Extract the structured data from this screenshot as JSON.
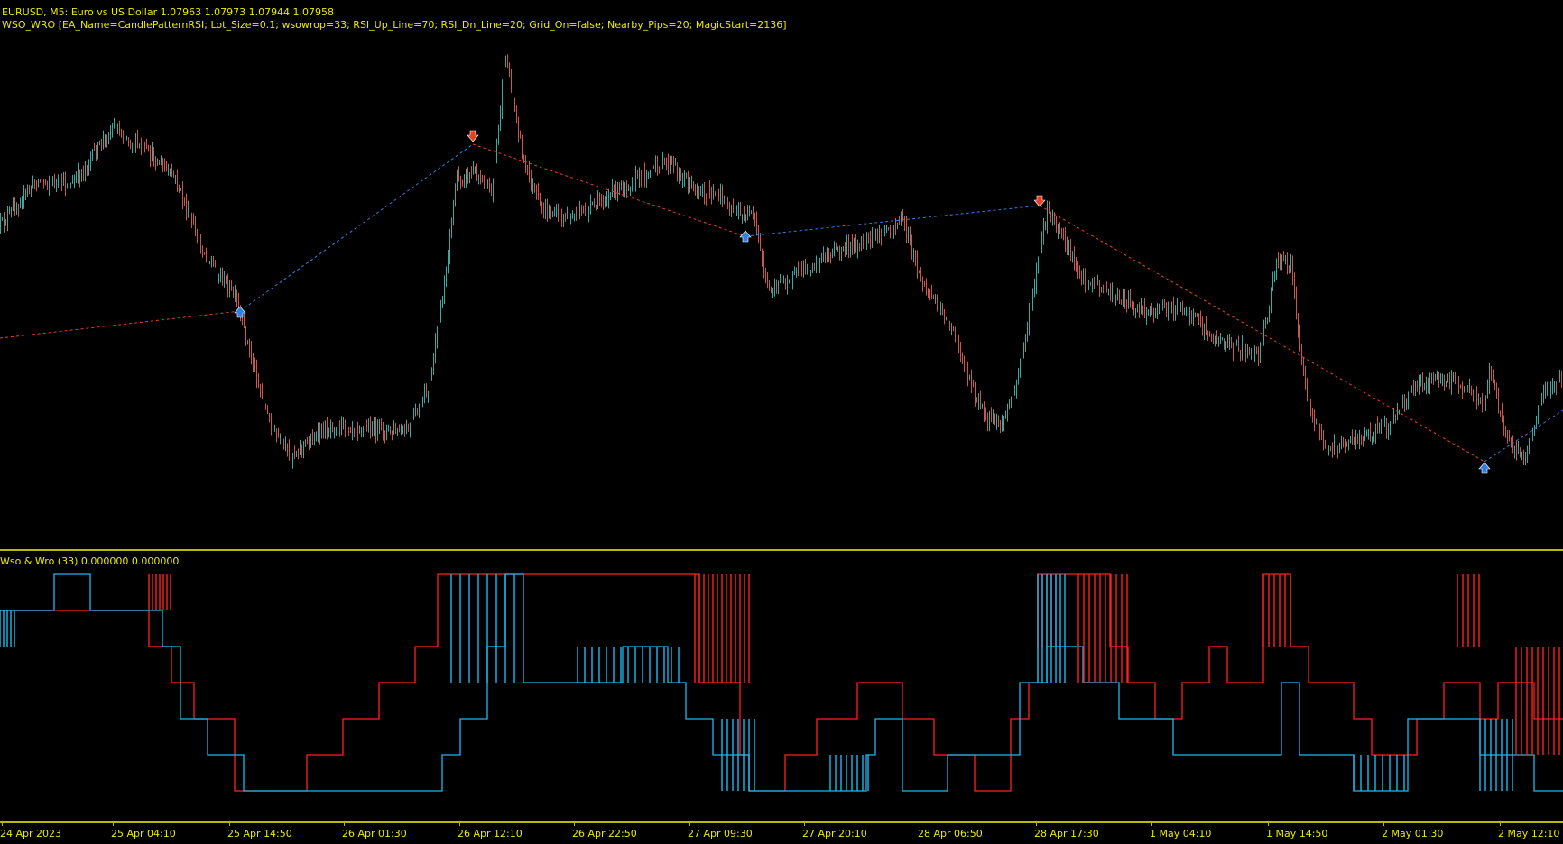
{
  "header": {
    "symbol_line": "EURUSD, M5:  Euro vs US Dollar  1.07963 1.07973 1.07944 1.07958",
    "ea_line": "WSO_WRO [EA_Name=CandlePatternRSI; Lot_Size=0.1; wsowrop=33; RSI_Up_Line=70; RSI_Dn_Line=20; Grid_On=false; Nearby_Pips=20; MagicStart=2136]"
  },
  "indicator": {
    "label": "Wso & Wro (33) 0.000000 0.000000"
  },
  "colors": {
    "background": "#000000",
    "text": "#e9e900",
    "separator": "#b9b900",
    "bull_candle": "#3fa7a0",
    "bear_candle": "#c9574f",
    "wso_line": "#ff2020",
    "wro_line": "#1fb8f0",
    "buy_arrow": "#2f7fe0",
    "sell_arrow": "#e8401e",
    "dotted_down": "#e8401e",
    "dotted_up": "#2f7fe0"
  },
  "time_axis": [
    "24 Apr 2023",
    "25 Apr 04:10",
    "25 Apr 14:50",
    "26 Apr 01:30",
    "26 Apr 12:10",
    "26 Apr 22:50",
    "27 Apr 09:30",
    "27 Apr 20:10",
    "28 Apr 06:50",
    "28 Apr 17:30",
    "1 May 04:10",
    "1 May 14:50",
    "2 May 01:30",
    "2 May 12:10"
  ],
  "signals": [
    {
      "type": "buy",
      "time": "25 Apr 14:50"
    },
    {
      "type": "sell",
      "time": "26 Apr 12:10"
    },
    {
      "type": "buy",
      "time": "27 Apr 09:30"
    },
    {
      "type": "sell",
      "time": "28 Apr 17:30"
    },
    {
      "type": "buy",
      "time": "2 May 12:10"
    }
  ]
}
